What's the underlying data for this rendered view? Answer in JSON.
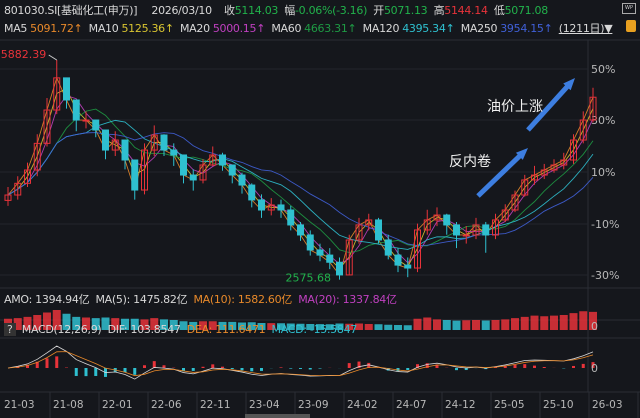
{
  "header": {
    "code_name": "801030.SI[基础化工(申万)]",
    "date": "2026/03/10",
    "close_label": "收",
    "close": "5114.03",
    "change_label": "幅",
    "change": "-0.06%(-3.16)",
    "open_label": "开",
    "open": "5071.13",
    "high_label": "高",
    "high": "5144.14",
    "low_label": "低",
    "low": "5071.08"
  },
  "ma_row": {
    "ma5_label": "MA5",
    "ma5": "5091.72↑",
    "ma10_label": "MA10",
    "ma10": "5125.36↑",
    "ma20_label": "MA20",
    "ma20": "5000.15↑",
    "ma60_label": "MA60",
    "ma60": "4663.31↑",
    "ma120_label": "MA120",
    "ma120": "4395.34↑",
    "ma250_label": "MA250",
    "ma250": "3954.15↑",
    "period": "(1211日)▼"
  },
  "volume_row": {
    "amo": "AMO: 1394.94亿",
    "ma5": "MA(5): 1475.82亿",
    "ma10": "MA(10): 1582.60亿",
    "ma20": "MA(20): 1337.84亿",
    "zero_label": "0"
  },
  "macd_row": {
    "help": "?",
    "title": "MACD(12,26,9)",
    "dif": "DIF: 103.8547",
    "dea": "DEA: 111.6471",
    "macd": "MACD: -15.5847",
    "zero_label": "0"
  },
  "annotations": {
    "oil": "油价上涨",
    "anti_involution": "反内卷"
  },
  "colors": {
    "up": "#e8333a",
    "down": "#2fc0d0",
    "ma5": "#e8892a",
    "ma10": "#d9c531",
    "ma20": "#c040c0",
    "ma60": "#1e9a44",
    "ma120": "#2fc0d0",
    "ma250": "#4060d8",
    "arrow": "#3d7ee0"
  },
  "chart_data": {
    "type": "candlestick",
    "title": "",
    "y_axis": {
      "scale": "log",
      "position": "right",
      "tick_labels": [
        "50%",
        "30%",
        "10%",
        "-10%",
        "-30%"
      ]
    },
    "x_tick_labels": [
      "21-03",
      "21-08",
      "22-01",
      "22-06",
      "22-11",
      "23-04",
      "23-09",
      "24-02",
      "24-07",
      "24-12",
      "25-05",
      "25-10",
      "26-03"
    ],
    "max_label": "5882.39",
    "min_label": "2575.68",
    "months": [
      "21-03",
      "21-04",
      "21-05",
      "21-06",
      "21-07",
      "21-08",
      "21-09",
      "21-10",
      "21-11",
      "21-12",
      "22-01",
      "22-02",
      "22-03",
      "22-04",
      "22-05",
      "22-06",
      "22-07",
      "22-08",
      "22-09",
      "22-10",
      "22-11",
      "22-12",
      "23-01",
      "23-02",
      "23-03",
      "23-04",
      "23-05",
      "23-06",
      "23-07",
      "23-08",
      "23-09",
      "23-10",
      "23-11",
      "23-12",
      "24-01",
      "24-02",
      "24-03",
      "24-04",
      "24-05",
      "24-06",
      "24-07",
      "24-08",
      "24-09",
      "24-10",
      "24-11",
      "24-12",
      "25-01",
      "25-02",
      "25-03",
      "25-04",
      "25-05",
      "25-06",
      "25-07",
      "25-08",
      "25-09",
      "25-10",
      "25-11",
      "25-12",
      "26-01",
      "26-02",
      "26-03"
    ],
    "close": [
      3541,
      3700,
      3890,
      4300,
      4874,
      5500,
      5061,
      4694,
      4694,
      4521,
      4193,
      4354,
      4039,
      3608,
      4193,
      4437,
      4193,
      4116,
      3817,
      3747,
      3964,
      4116,
      3964,
      3817,
      3676,
      3476,
      3347,
      3411,
      3347,
      3164,
      3047,
      2880,
      2825,
      2750,
      2622,
      2990,
      3164,
      3224,
      2990,
      2825,
      2721,
      2691,
      3105,
      3224,
      3284,
      3164,
      3047,
      3047,
      3164,
      3047,
      3224,
      3347,
      3541,
      3747,
      3817,
      3890,
      3964,
      4039,
      4354,
      4694,
      5114
    ],
    "high": [
      3650,
      3800,
      4000,
      4450,
      5100,
      5882.39,
      5400,
      4900,
      4850,
      4700,
      4500,
      4500,
      4300,
      4000,
      4300,
      4600,
      4450,
      4300,
      4100,
      3900,
      4050,
      4250,
      4150,
      3950,
      3850,
      3700,
      3550,
      3500,
      3480,
      3400,
      3200,
      3100,
      2950,
      2900,
      2800,
      3050,
      3250,
      3300,
      3250,
      3050,
      2900,
      2800,
      3180,
      3350,
      3380,
      3300,
      3200,
      3150,
      3250,
      3200,
      3300,
      3420,
      3600,
      3820,
      3950,
      3980,
      4050,
      4150,
      4450,
      4850,
      5300
    ],
    "low": [
      3400,
      3480,
      3650,
      3800,
      4250,
      4800,
      4900,
      4500,
      4550,
      4400,
      4050,
      4100,
      3900,
      3480,
      3550,
      4100,
      4100,
      3950,
      3700,
      3600,
      3700,
      3950,
      3880,
      3700,
      3560,
      3380,
      3250,
      3280,
      3250,
      3100,
      2980,
      2820,
      2760,
      2680,
      2575.68,
      2620,
      2950,
      3100,
      2950,
      2780,
      2650,
      2600,
      2650,
      3050,
      3150,
      3050,
      2900,
      2950,
      3000,
      2850,
      3000,
      3200,
      3320,
      3520,
      3680,
      3760,
      3850,
      3900,
      3980,
      4300,
      4650
    ],
    "amo": [
      900,
      950,
      1050,
      1200,
      1400,
      1600,
      1300,
      1050,
      1000,
      950,
      1000,
      950,
      900,
      900,
      850,
      950,
      850,
      800,
      700,
      650,
      700,
      700,
      650,
      650,
      600,
      620,
      560,
      550,
      540,
      520,
      500,
      480,
      470,
      460,
      520,
      500,
      520,
      480,
      460,
      420,
      400,
      380,
      900,
      1000,
      850,
      800,
      750,
      780,
      800,
      760,
      800,
      850,
      950,
      1050,
      1150,
      1100,
      1150,
      1200,
      1350,
      1500,
      1450
    ]
  }
}
